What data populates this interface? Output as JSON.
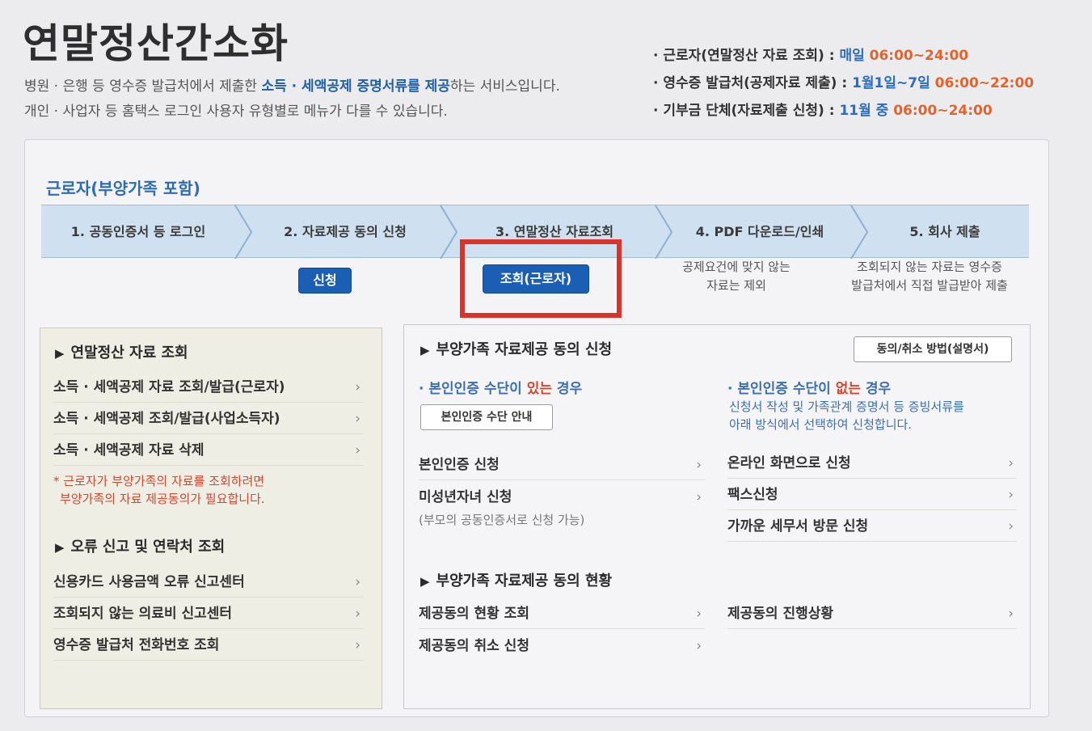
{
  "title": "연말정산간소화",
  "intro": {
    "line1_pre": "병원 · 은행 등 영수증 발급처에서 제출한 ",
    "line1_hl": "소득 · 세액공제 증명서류를 제공",
    "line1_post": "하는 서비스입니다.",
    "line2": "개인 · 사업자 등 홈택스 로그인 사용자 유형별로 메뉴가 다를 수 있습니다."
  },
  "hours": [
    {
      "label": "· 근로자(연말정산 자료 조회) : ",
      "day": "매일 ",
      "time": "06:00~24:00"
    },
    {
      "label": "· 영수증 발급처(공제자료 제출) : ",
      "day": "1월1일~7일 ",
      "time": "06:00~22:00"
    },
    {
      "label": "· 기부금 단체(자료제출 신청) : ",
      "day": "11월 중 ",
      "time": "06:00~24:00"
    }
  ],
  "section_title": "근로자(부양가족 포함)",
  "steps": [
    "1. 공동인증서 등 로그인",
    "2. 자료제공 동의 신청",
    "3. 연말정산 자료조회",
    "4. PDF 다운로드/인쇄",
    "5. 회사 제출"
  ],
  "apply_button": "신청",
  "inquiry_button": "조회(근로자)",
  "step4_note": [
    "공제요건에 맞지 않는",
    "자료는 제외"
  ],
  "step5_note": [
    "조회되지 않는 자료는 영수증",
    "발급처에서 직접 발급받아 제출"
  ],
  "left": {
    "head1": "연말정산 자료 조회",
    "items1": [
      "소득 · 세액공제 자료 조회/발급(근로자)",
      "소득 · 세액공제 조회/발급(사업소득자)",
      "소득 · 세액공제 자료 삭제"
    ],
    "note": [
      "* 근로자가 부양가족의 자료를 조회하려면",
      "부양가족의 자료 제공동의가 필요합니다."
    ],
    "head2": "오류 신고 및 연락처 조회",
    "items2": [
      "신용카드 사용금액 오류 신고센터",
      "조회되지 않는 의료비 신고센터",
      "영수증 발급처 전화번호 조회"
    ]
  },
  "right": {
    "head1": "부양가족 자료제공 동의 신청",
    "guide_button": "동의/취소 방법(설명서)",
    "with_auth_pre": "· 본인인증 수단이 ",
    "with_auth_red": "있는",
    "with_auth_post": " 경우",
    "auth_guide_button": "본인인증 수단 안내",
    "without_auth_pre": "· 본인인증 수단이 ",
    "without_auth_red": "없는",
    "without_auth_post": " 경우",
    "without_desc": [
      "신청서 작성 및 가족관계 증명서 등 증빙서류를",
      "아래 방식에서 선택하여 신청합니다."
    ],
    "left_items": [
      "본인인증 신청",
      "미성년자녀 신청"
    ],
    "minor_note": "(부모의 공동인증서로 신청 가능)",
    "right_items": [
      "온라인 화면으로 신청",
      "팩스신청",
      "가까운 세무서 방문 신청"
    ],
    "head2": "부양가족 자료제공 동의 현황",
    "status_left": [
      "제공동의 현황 조회",
      "제공동의 취소 신청"
    ],
    "status_right": [
      "제공동의 진행상황"
    ]
  },
  "colors": {
    "accent": "#1a5fb4",
    "highlight_box": "#d9342b",
    "orange": "#e2632c"
  }
}
